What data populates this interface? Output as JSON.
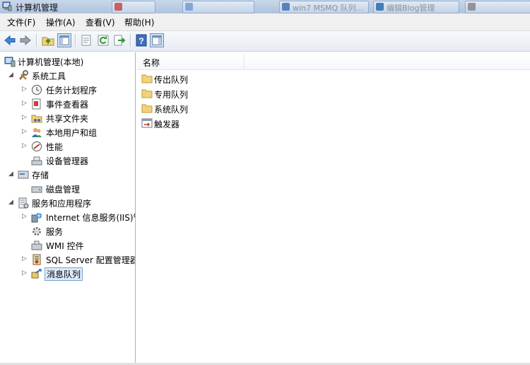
{
  "window": {
    "title": "计算机管理"
  },
  "taskbar_ghosts": [
    "",
    "",
    "win7 MSMQ 队列...",
    "编辑Blog管理",
    ""
  ],
  "menu": [
    {
      "label": "文件(F)"
    },
    {
      "label": "操作(A)"
    },
    {
      "label": "查看(V)"
    },
    {
      "label": "帮助(H)"
    }
  ],
  "toolbar": {
    "back": "back-arrow-icon",
    "forward": "forward-arrow-icon",
    "up": "up-folder-icon",
    "show_hide_tree": "console-tree-icon",
    "properties": "properties-icon",
    "refresh": "refresh-icon",
    "export": "export-list-icon",
    "help": "help-icon",
    "show_action_pane": "action-pane-icon"
  },
  "tree": {
    "root": "计算机管理(本地)",
    "system_tools": "系统工具",
    "task_scheduler": "任务计划程序",
    "event_viewer": "事件查看器",
    "shared_folders": "共享文件夹",
    "local_users": "本地用户和组",
    "performance": "性能",
    "device_manager": "设备管理器",
    "storage": "存储",
    "disk_management": "磁盘管理",
    "services_apps": "服务和应用程序",
    "iis": "Internet 信息服务(IIS)管",
    "services": "服务",
    "wmi": "WMI 控件",
    "sql_server": "SQL Server 配置管理器",
    "message_queuing": "消息队列"
  },
  "list": {
    "column_name": "名称",
    "items": [
      {
        "label": "传出队列",
        "icon": "folder-icon"
      },
      {
        "label": "专用队列",
        "icon": "folder-icon"
      },
      {
        "label": "系统队列",
        "icon": "folder-icon"
      },
      {
        "label": "触发器",
        "icon": "triggers-icon"
      }
    ]
  },
  "colors": {
    "folder": "#f3d27a",
    "selection": "#dce9f8",
    "titlebar": "#b9cbe3"
  }
}
